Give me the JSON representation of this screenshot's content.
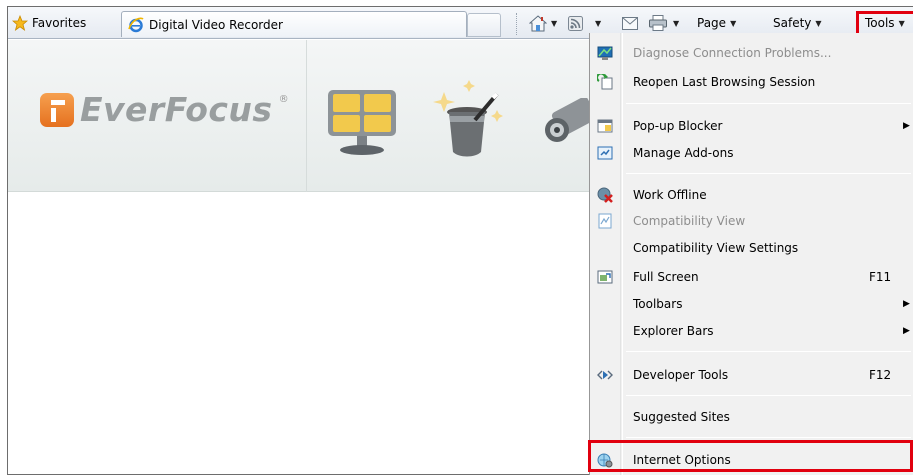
{
  "toolbar": {
    "favorites_label": "Favorites",
    "tab_title": "Digital Video Recorder",
    "page_label": "Page",
    "safety_label": "Safety",
    "tools_label": "Tools"
  },
  "brand": {
    "name": "EverFocus",
    "reg_mark": "®"
  },
  "menu": {
    "items": [
      {
        "label": "Diagnose Connection Problems...",
        "disabled": true,
        "icon": "network-diagnose-icon"
      },
      {
        "label": "Reopen Last Browsing Session",
        "icon": "reopen-session-icon"
      },
      {
        "label": "Pop-up Blocker",
        "submenu": true,
        "icon": "popup-blocker-icon"
      },
      {
        "label": "Manage Add-ons",
        "icon": "addons-icon"
      },
      {
        "label": "Work Offline",
        "icon": "work-offline-icon"
      },
      {
        "label": "Compatibility View",
        "disabled": true,
        "icon": "compatibility-view-icon"
      },
      {
        "label": "Compatibility View Settings"
      },
      {
        "label": "Full Screen",
        "shortcut": "F11",
        "icon": "full-screen-icon"
      },
      {
        "label": "Toolbars",
        "submenu": true
      },
      {
        "label": "Explorer Bars",
        "submenu": true
      },
      {
        "label": "Developer Tools",
        "shortcut": "F12",
        "icon": "developer-tools-icon"
      },
      {
        "label": "Suggested Sites"
      },
      {
        "label": "Internet Options",
        "icon": "internet-options-icon"
      }
    ]
  },
  "colors": {
    "highlight": "#e1000f",
    "logo_orange": "#e5711f",
    "logo_grey": "#999e9f"
  }
}
